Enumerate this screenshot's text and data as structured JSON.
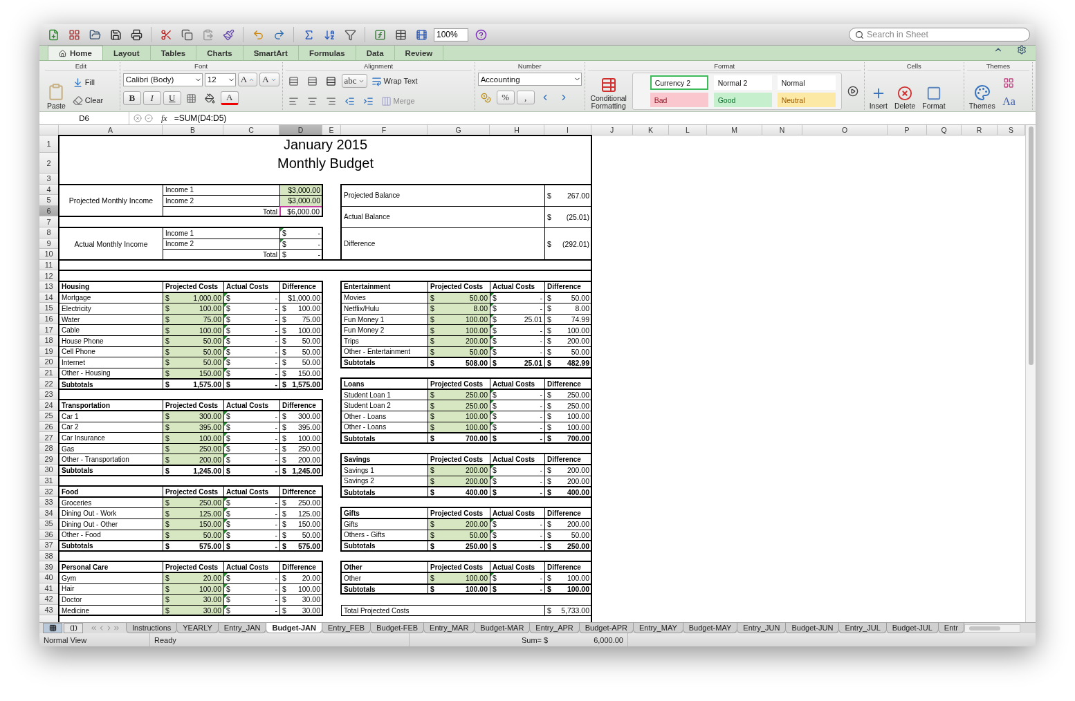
{
  "toolbar": {
    "zoom": "100%",
    "search_placeholder": "Search in Sheet"
  },
  "ribbon_tabs": [
    {
      "label": "Home",
      "selected": true
    },
    {
      "label": "Layout",
      "selected": false
    },
    {
      "label": "Tables",
      "selected": false
    },
    {
      "label": "Charts",
      "selected": false
    },
    {
      "label": "SmartArt",
      "selected": false
    },
    {
      "label": "Formulas",
      "selected": false
    },
    {
      "label": "Data",
      "selected": false
    },
    {
      "label": "Review",
      "selected": false
    }
  ],
  "ribbon": {
    "edit": {
      "title": "Edit",
      "paste": "Paste",
      "fill": "Fill",
      "clear": "Clear"
    },
    "font": {
      "title": "Font",
      "font_name": "Calibri (Body)",
      "font_size": "12",
      "grow": "A",
      "shrink": "A",
      "bold": "B",
      "italic": "I",
      "underline": "U",
      "font_color": "A"
    },
    "alignment": {
      "title": "Alignment",
      "orientation": "abc",
      "wrap": "Wrap Text",
      "merge": "Merge"
    },
    "number": {
      "title": "Number",
      "format": "Accounting",
      "percent": "%",
      "comma": ","
    },
    "format": {
      "title": "Format",
      "conditional": "Conditional Formatting",
      "styles": [
        {
          "label": "Currency 2",
          "kind": "normal",
          "selected": true
        },
        {
          "label": "Normal 2",
          "kind": "normal",
          "selected": false
        },
        {
          "label": "Normal",
          "kind": "normal",
          "selected": false
        },
        {
          "label": "Bad",
          "kind": "bad",
          "selected": false
        },
        {
          "label": "Good",
          "kind": "good",
          "selected": false
        },
        {
          "label": "Neutral",
          "kind": "neutral",
          "selected": false
        }
      ]
    },
    "cells": {
      "title": "Cells",
      "buttons": [
        "Insert",
        "Delete",
        "Format"
      ]
    },
    "themes": {
      "title": "Themes",
      "button": "Themes",
      "fonts": "Aa"
    }
  },
  "formula_bar": {
    "cell": "D6",
    "fx": "fx",
    "formula": "=SUM(D4:D5)"
  },
  "columns": [
    {
      "label": "A",
      "selected": false
    },
    {
      "label": "B",
      "selected": false
    },
    {
      "label": "C",
      "selected": false
    },
    {
      "label": "D",
      "selected": true
    },
    {
      "label": "E",
      "selected": false
    },
    {
      "label": "F",
      "selected": false
    },
    {
      "label": "G",
      "selected": false
    },
    {
      "label": "H",
      "selected": false
    },
    {
      "label": "I",
      "selected": false
    },
    {
      "label": "J",
      "selected": false
    },
    {
      "label": "K",
      "selected": false
    },
    {
      "label": "L",
      "selected": false
    },
    {
      "label": "M",
      "selected": false
    },
    {
      "label": "N",
      "selected": false
    },
    {
      "label": "O",
      "selected": false
    },
    {
      "label": "P",
      "selected": false
    },
    {
      "label": "Q",
      "selected": false
    },
    {
      "label": "R",
      "selected": false
    },
    {
      "label": "S",
      "selected": false
    }
  ],
  "row_numbers": [
    {
      "label": "1",
      "selected": false
    },
    {
      "label": "2",
      "selected": false
    },
    {
      "label": "3",
      "selected": false
    },
    {
      "label": "4",
      "selected": false
    },
    {
      "label": "5",
      "selected": false
    },
    {
      "label": "6",
      "selected": true
    },
    {
      "label": "7",
      "selected": false
    },
    {
      "label": "8",
      "selected": false
    },
    {
      "label": "9",
      "selected": false
    },
    {
      "label": "10",
      "selected": false
    },
    {
      "label": "11",
      "selected": false
    },
    {
      "label": "12",
      "selected": false
    },
    {
      "label": "13",
      "selected": false
    },
    {
      "label": "14",
      "selected": false
    },
    {
      "label": "15",
      "selected": false
    },
    {
      "label": "16",
      "selected": false
    },
    {
      "label": "17",
      "selected": false
    },
    {
      "label": "18",
      "selected": false
    },
    {
      "label": "19",
      "selected": false
    },
    {
      "label": "20",
      "selected": false
    },
    {
      "label": "21",
      "selected": false
    },
    {
      "label": "22",
      "selected": false
    },
    {
      "label": "23",
      "selected": false
    },
    {
      "label": "24",
      "selected": false
    },
    {
      "label": "25",
      "selected": false
    },
    {
      "label": "26",
      "selected": false
    },
    {
      "label": "27",
      "selected": false
    },
    {
      "label": "28",
      "selected": false
    },
    {
      "label": "29",
      "selected": false
    },
    {
      "label": "30",
      "selected": false
    },
    {
      "label": "31",
      "selected": false
    },
    {
      "label": "32",
      "selected": false
    },
    {
      "label": "33",
      "selected": false
    },
    {
      "label": "34",
      "selected": false
    },
    {
      "label": "35",
      "selected": false
    },
    {
      "label": "36",
      "selected": false
    },
    {
      "label": "37",
      "selected": false
    },
    {
      "label": "38",
      "selected": false
    },
    {
      "label": "39",
      "selected": false
    },
    {
      "label": "40",
      "selected": false
    },
    {
      "label": "41",
      "selected": false
    },
    {
      "label": "42",
      "selected": false
    },
    {
      "label": "43",
      "selected": false
    }
  ],
  "title": [
    "January 2015",
    "Monthly Budget"
  ],
  "income": [
    {
      "label": "Projected Monthly Income",
      "kind": "input",
      "items": [
        {
          "label": "Income 1",
          "value": "$3,000.00"
        },
        {
          "label": "Income 2",
          "value": "$3,000.00"
        }
      ],
      "total_label": "Total",
      "total": "$6,000.00",
      "selected": true
    },
    {
      "label": "Actual Monthly Income",
      "kind": "entry",
      "items": [
        {
          "label": "Income 1",
          "value": "$ -"
        },
        {
          "label": "Income 2",
          "value": "$ -"
        }
      ],
      "total_label": "Total",
      "total": "$ -",
      "selected": false
    }
  ],
  "balance": [
    {
      "label": "Projected Balance",
      "value": "$ 267.00"
    },
    {
      "label": "Actual Balance",
      "value": "$ (25.01)"
    },
    {
      "label": "Difference",
      "value": "$ (292.01)"
    }
  ],
  "left_tables": [
    {
      "name": "Housing",
      "columns": [
        "Projected Costs",
        "Actual Costs",
        "Difference"
      ],
      "items": [
        {
          "label": "Mortgage",
          "projected": "$ 1,000.00",
          "actual": "$ -",
          "difference": "$1,000.00"
        },
        {
          "label": "Electricity",
          "projected": "$ 100.00",
          "actual": "$ -",
          "difference": "$ 100.00"
        },
        {
          "label": "Water",
          "projected": "$ 75.00",
          "actual": "$ -",
          "difference": "$ 75.00"
        },
        {
          "label": "Cable",
          "projected": "$ 100.00",
          "actual": "$ -",
          "difference": "$ 100.00"
        },
        {
          "label": "House Phone",
          "projected": "$ 50.00",
          "actual": "$ -",
          "difference": "$ 50.00"
        },
        {
          "label": "Cell Phone",
          "projected": "$ 50.00",
          "actual": "$ -",
          "difference": "$ 50.00"
        },
        {
          "label": "Internet",
          "projected": "$ 50.00",
          "actual": "$ -",
          "difference": "$ 50.00"
        },
        {
          "label": "Other - Housing",
          "projected": "$ 150.00",
          "actual": "$ -",
          "difference": "$ 150.00"
        }
      ],
      "subtotal": {
        "label": "Subtotals",
        "projected": "$ 1,575.00",
        "actual": "$ -",
        "difference": "$ 1,575.00"
      }
    },
    {
      "name": "Transportation",
      "columns": [
        "Projected Costs",
        "Actual Costs",
        "Difference"
      ],
      "items": [
        {
          "label": "Car 1",
          "projected": "$ 300.00",
          "actual": "$ -",
          "difference": "$ 300.00"
        },
        {
          "label": "Car 2",
          "projected": "$ 395.00",
          "actual": "$ -",
          "difference": "$ 395.00"
        },
        {
          "label": "Car Insurance",
          "projected": "$ 100.00",
          "actual": "$ -",
          "difference": "$ 100.00"
        },
        {
          "label": "Gas",
          "projected": "$ 250.00",
          "actual": "$ -",
          "difference": "$ 250.00"
        },
        {
          "label": "Other - Transportation",
          "projected": "$ 200.00",
          "actual": "$ -",
          "difference": "$ 200.00"
        }
      ],
      "subtotal": {
        "label": "Subtotals",
        "projected": "$ 1,245.00",
        "actual": "$ -",
        "difference": "$ 1,245.00"
      }
    },
    {
      "name": "Food",
      "columns": [
        "Projected Costs",
        "Actual Costs",
        "Difference"
      ],
      "items": [
        {
          "label": "Groceries",
          "projected": "$ 250.00",
          "actual": "$ -",
          "difference": "$ 250.00"
        },
        {
          "label": "Dining Out - Work",
          "projected": "$ 125.00",
          "actual": "$ -",
          "difference": "$ 125.00"
        },
        {
          "label": "Dining Out - Other",
          "projected": "$ 150.00",
          "actual": "$ -",
          "difference": "$ 150.00"
        },
        {
          "label": "Other - Food",
          "projected": "$ 50.00",
          "actual": "$ -",
          "difference": "$ 50.00"
        }
      ],
      "subtotal": {
        "label": "Subtotals",
        "projected": "$ 575.00",
        "actual": "$ -",
        "difference": "$ 575.00"
      }
    },
    {
      "name": "Personal Care",
      "columns": [
        "Projected Costs",
        "Actual Costs",
        "Difference"
      ],
      "items": [
        {
          "label": "Gym",
          "projected": "$ 20.00",
          "actual": "$ -",
          "difference": "$ 20.00"
        },
        {
          "label": "Hair",
          "projected": "$ 100.00",
          "actual": "$ -",
          "difference": "$ 100.00"
        },
        {
          "label": "Doctor",
          "projected": "$ 30.00",
          "actual": "$ -",
          "difference": "$ 30.00"
        },
        {
          "label": "Medicine",
          "projected": "$ 30.00",
          "actual": "$ -",
          "difference": "$ 30.00"
        }
      ]
    }
  ],
  "right_tables": [
    {
      "name": "Entertainment",
      "columns": [
        "Projected Costs",
        "Actual Costs",
        "Difference"
      ],
      "items": [
        {
          "label": "Movies",
          "projected": "$ 50.00",
          "actual": "$ -",
          "difference": "$ 50.00"
        },
        {
          "label": "Netflix/Hulu",
          "projected": "$ 8.00",
          "actual": "$ -",
          "difference": "$ 8.00"
        },
        {
          "label": "Fun Money 1",
          "projected": "$ 100.00",
          "actual": "$ 25.01",
          "difference": "$ 74.99"
        },
        {
          "label": "Fun Money 2",
          "projected": "$ 100.00",
          "actual": "$ -",
          "difference": "$ 100.00"
        },
        {
          "label": "Trips",
          "projected": "$ 200.00",
          "actual": "$ -",
          "difference": "$ 200.00"
        },
        {
          "label": "Other - Entertainment",
          "projected": "$ 50.00",
          "actual": "$ -",
          "difference": "$ 50.00"
        }
      ],
      "subtotal": {
        "label": "Subtotals",
        "projected": "$ 508.00",
        "actual": "$ 25.01",
        "difference": "$ 482.99"
      }
    },
    {
      "name": "Loans",
      "columns": [
        "Projected Costs",
        "Actual Costs",
        "Difference"
      ],
      "items": [
        {
          "label": "Student Loan 1",
          "projected": "$ 250.00",
          "actual": "$ -",
          "difference": "$ 250.00"
        },
        {
          "label": "Student Loan 2",
          "projected": "$ 250.00",
          "actual": "$ -",
          "difference": "$ 250.00"
        },
        {
          "label": "Other - Loans",
          "projected": "$ 100.00",
          "actual": "$ -",
          "difference": "$ 100.00"
        },
        {
          "label": "Other - Loans",
          "projected": "$ 100.00",
          "actual": "$ -",
          "difference": "$ 100.00"
        }
      ],
      "subtotal": {
        "label": "Subtotals",
        "projected": "$ 700.00",
        "actual": "$ -",
        "difference": "$ 700.00"
      }
    },
    {
      "name": "Savings",
      "columns": [
        "Projected Costs",
        "Actual Costs",
        "Difference"
      ],
      "items": [
        {
          "label": "Savings 1",
          "projected": "$ 200.00",
          "actual": "$ -",
          "difference": "$ 200.00"
        },
        {
          "label": "Savings 2",
          "projected": "$ 200.00",
          "actual": "$ -",
          "difference": "$ 200.00"
        }
      ],
      "subtotal": {
        "label": "Subtotals",
        "projected": "$ 400.00",
        "actual": "$ -",
        "difference": "$ 400.00"
      }
    },
    {
      "name": "Gifts",
      "columns": [
        "Projected Costs",
        "Actual Costs",
        "Difference"
      ],
      "items": [
        {
          "label": "Gifts",
          "projected": "$ 200.00",
          "actual": "$ -",
          "difference": "$ 200.00"
        },
        {
          "label": "Others - Gifts",
          "projected": "$ 50.00",
          "actual": "$ -",
          "difference": "$ 50.00"
        }
      ],
      "subtotal": {
        "label": "Subtotals",
        "projected": "$ 250.00",
        "actual": "$ -",
        "difference": "$ 250.00"
      }
    },
    {
      "name": "Other",
      "columns": [
        "Projected Costs",
        "Actual Costs",
        "Difference"
      ],
      "items": [
        {
          "label": "Other",
          "projected": "$ 100.00",
          "actual": "$ -",
          "difference": "$ 100.00"
        }
      ],
      "subtotal": {
        "label": "Subtotals",
        "projected": "$ 100.00",
        "actual": "$ -",
        "difference": "$ 100.00"
      }
    }
  ],
  "totals": [
    {
      "label": "Total Projected Costs",
      "value": "$ 5,733.00"
    }
  ],
  "sheet_tabs": [
    {
      "label": "Instructions",
      "selected": false
    },
    {
      "label": "YEARLY",
      "selected": false
    },
    {
      "label": "Entry_JAN",
      "selected": false
    },
    {
      "label": "Budget-JAN",
      "selected": true
    },
    {
      "label": "Entry_FEB",
      "selected": false
    },
    {
      "label": "Budget-FEB",
      "selected": false
    },
    {
      "label": "Entry_MAR",
      "selected": false
    },
    {
      "label": "Budget-MAR",
      "selected": false
    },
    {
      "label": "Entry_APR",
      "selected": false
    },
    {
      "label": "Budget-APR",
      "selected": false
    },
    {
      "label": "Entry_MAY",
      "selected": false
    },
    {
      "label": "Budget-MAY",
      "selected": false
    },
    {
      "label": "Entry_JUN",
      "selected": false
    },
    {
      "label": "Budget-JUN",
      "selected": false
    },
    {
      "label": "Entry_JUL",
      "selected": false
    },
    {
      "label": "Budget-JUL",
      "selected": false
    },
    {
      "label": "Entr",
      "selected": false
    }
  ],
  "status_bar": {
    "view": "Normal View",
    "status": "Ready",
    "sum_label": "Sum= $",
    "sum_value": "6,000.00"
  }
}
